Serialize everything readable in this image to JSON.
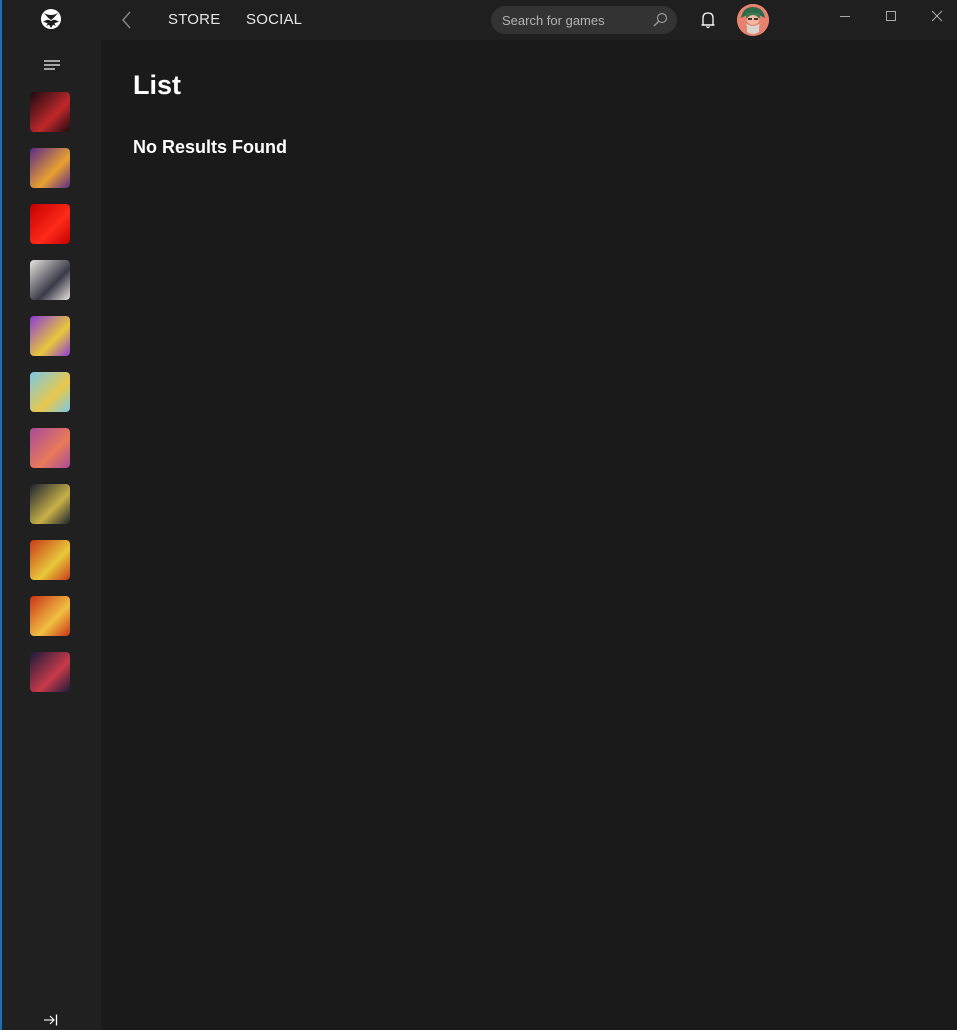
{
  "titlebar": {
    "logo": "xbox-logo-icon",
    "back_icon": "chevron-left-icon",
    "nav": [
      {
        "label": "STORE"
      },
      {
        "label": "SOCIAL"
      }
    ],
    "search": {
      "placeholder": "Search for games",
      "value": "",
      "icon": "search-icon"
    },
    "notifications_icon": "bell-icon",
    "avatar_icon": "user-avatar",
    "window_controls": {
      "minimize": "minimize-icon",
      "maximize": "maximize-icon",
      "close": "close-icon"
    }
  },
  "sidebar": {
    "menu_icon": "hamburger-menu-icon",
    "collapse_icon": "expand-arrow-icon",
    "games": [
      {
        "name": "stranger-things-3-the-game",
        "colors": [
          "#1a0a10",
          "#c0282a"
        ]
      },
      {
        "name": "guacamelee-2",
        "colors": [
          "#5a2a8a",
          "#e8a030"
        ]
      },
      {
        "name": "wolfenstein-youngblood-red",
        "colors": [
          "#c40000",
          "#ff2a1a"
        ]
      },
      {
        "name": "darksiders-genesis",
        "colors": [
          "#e8e4de",
          "#3a3a48"
        ]
      },
      {
        "name": "enter-the-gungeon",
        "colors": [
          "#8a3ad8",
          "#e8c83a"
        ]
      },
      {
        "name": "moving-out",
        "colors": [
          "#7ac8e8",
          "#e8c84a"
        ]
      },
      {
        "name": "purple-platformer",
        "colors": [
          "#a84a9a",
          "#e87a5a"
        ]
      },
      {
        "name": "halo-master-chief-collection",
        "colors": [
          "#1a2230",
          "#c8b048"
        ]
      },
      {
        "name": "colorful-action-game",
        "colors": [
          "#c83a1a",
          "#e8c83a"
        ]
      },
      {
        "name": "broforce",
        "colors": [
          "#c8321a",
          "#f0c040"
        ]
      },
      {
        "name": "marvel-heroes-game",
        "colors": [
          "#1a1a3a",
          "#c83a4a"
        ]
      }
    ]
  },
  "main": {
    "title": "List",
    "empty_message": "No Results Found"
  }
}
